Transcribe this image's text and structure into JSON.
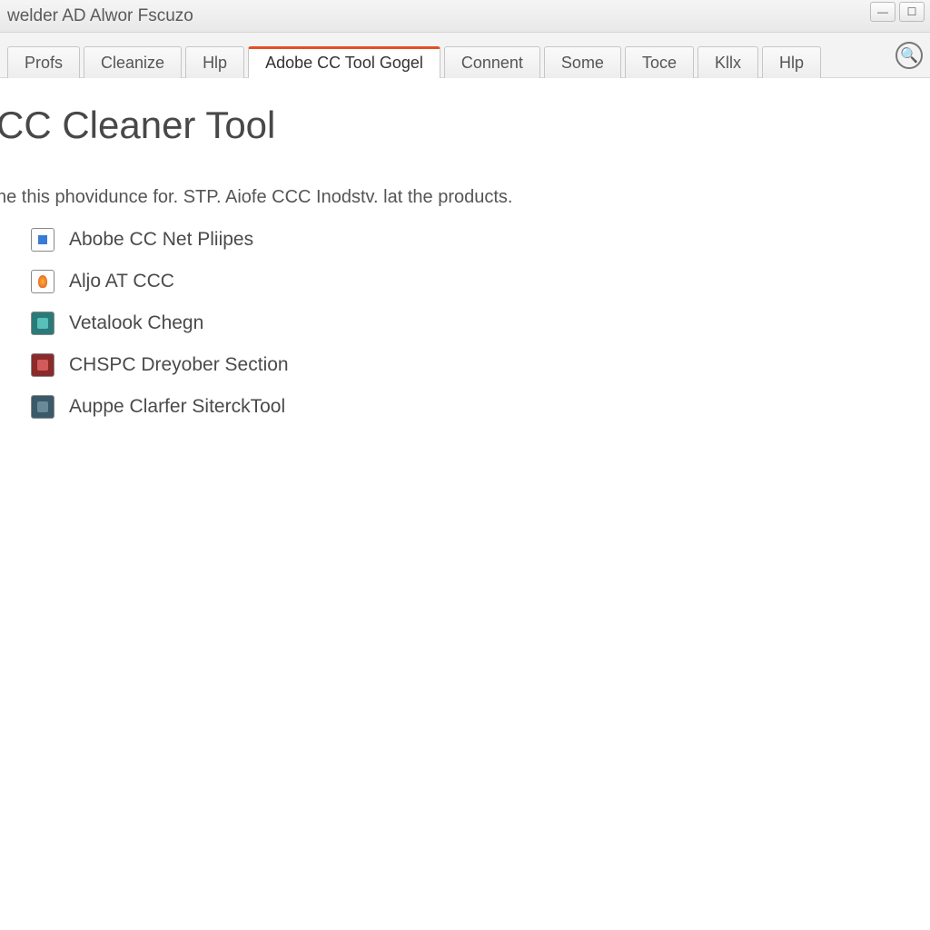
{
  "window": {
    "title": "welder AD Alwor Fscuzo"
  },
  "tabs": [
    {
      "label": "Profs",
      "active": false
    },
    {
      "label": "Cleanize",
      "active": false
    },
    {
      "label": "Hlp",
      "active": false
    },
    {
      "label": "Adobe CC Tool Gogel",
      "active": true
    },
    {
      "label": "Connent",
      "active": false
    },
    {
      "label": "Some",
      "active": false
    },
    {
      "label": "Toce",
      "active": false
    },
    {
      "label": "Kllx",
      "active": false
    },
    {
      "label": "Hlp",
      "active": false
    }
  ],
  "page": {
    "title": "CC Cleaner Tool",
    "intro": "ne this phovidunce for. STP. Aiofe CCC Inodstv. lat the products."
  },
  "items": [
    {
      "label": "Abobe CC Net Pliipes",
      "icon": "ic-blue"
    },
    {
      "label": "Aljo AT CCC",
      "icon": "ic-fire"
    },
    {
      "label": "Vetalook Chegn",
      "icon": "ic-teal"
    },
    {
      "label": "CHSPC Dreyober Section",
      "icon": "ic-red"
    },
    {
      "label": "Auppe Clarfer SiterckTool",
      "icon": "ic-dark"
    }
  ]
}
